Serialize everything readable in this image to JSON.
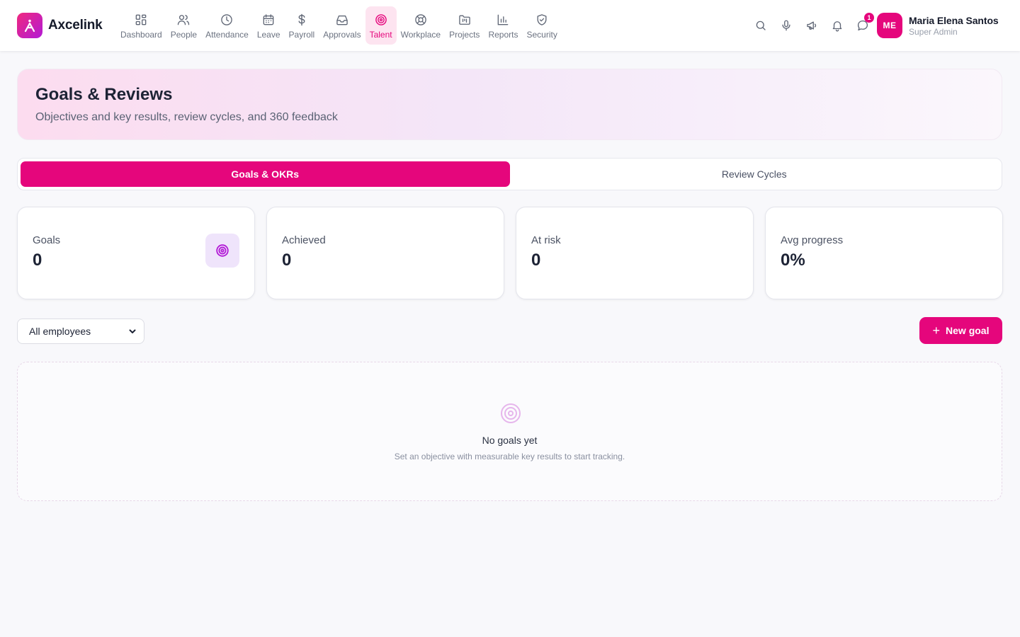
{
  "app": {
    "name": "Axcelink",
    "accent": "#e5067c"
  },
  "nav": {
    "items": [
      {
        "label": "Dashboard",
        "icon": "grid-icon"
      },
      {
        "label": "People",
        "icon": "users-icon"
      },
      {
        "label": "Attendance",
        "icon": "clock-icon"
      },
      {
        "label": "Leave",
        "icon": "calendar-icon"
      },
      {
        "label": "Payroll",
        "icon": "dollar-icon"
      },
      {
        "label": "Approvals",
        "icon": "inbox-icon"
      },
      {
        "label": "Talent",
        "icon": "target-icon",
        "active": true
      },
      {
        "label": "Workplace",
        "icon": "lifebuoy-icon"
      },
      {
        "label": "Projects",
        "icon": "kanban-icon"
      },
      {
        "label": "Reports",
        "icon": "bar-chart-icon"
      },
      {
        "label": "Security",
        "icon": "shield-icon"
      }
    ]
  },
  "header_actions": {
    "chat_badge": "1"
  },
  "user": {
    "initials": "ME",
    "name": "Maria Elena Santos",
    "role": "Super Admin"
  },
  "hero": {
    "title": "Goals & Reviews",
    "subtitle": "Objectives and key results, review cycles, and 360 feedback"
  },
  "tabs": [
    {
      "label": "Goals & OKRs",
      "active": true
    },
    {
      "label": "Review Cycles",
      "active": false
    }
  ],
  "stats": [
    {
      "label": "Goals",
      "value": "0"
    },
    {
      "label": "Achieved",
      "value": "0"
    },
    {
      "label": "At risk",
      "value": "0"
    },
    {
      "label": "Avg progress",
      "value": "0%"
    }
  ],
  "filter": {
    "selected": "All employees"
  },
  "new_goal_button": {
    "label": "New goal"
  },
  "empty_state": {
    "title": "No goals yet",
    "subtitle": "Set an objective with measurable key results to start tracking."
  }
}
